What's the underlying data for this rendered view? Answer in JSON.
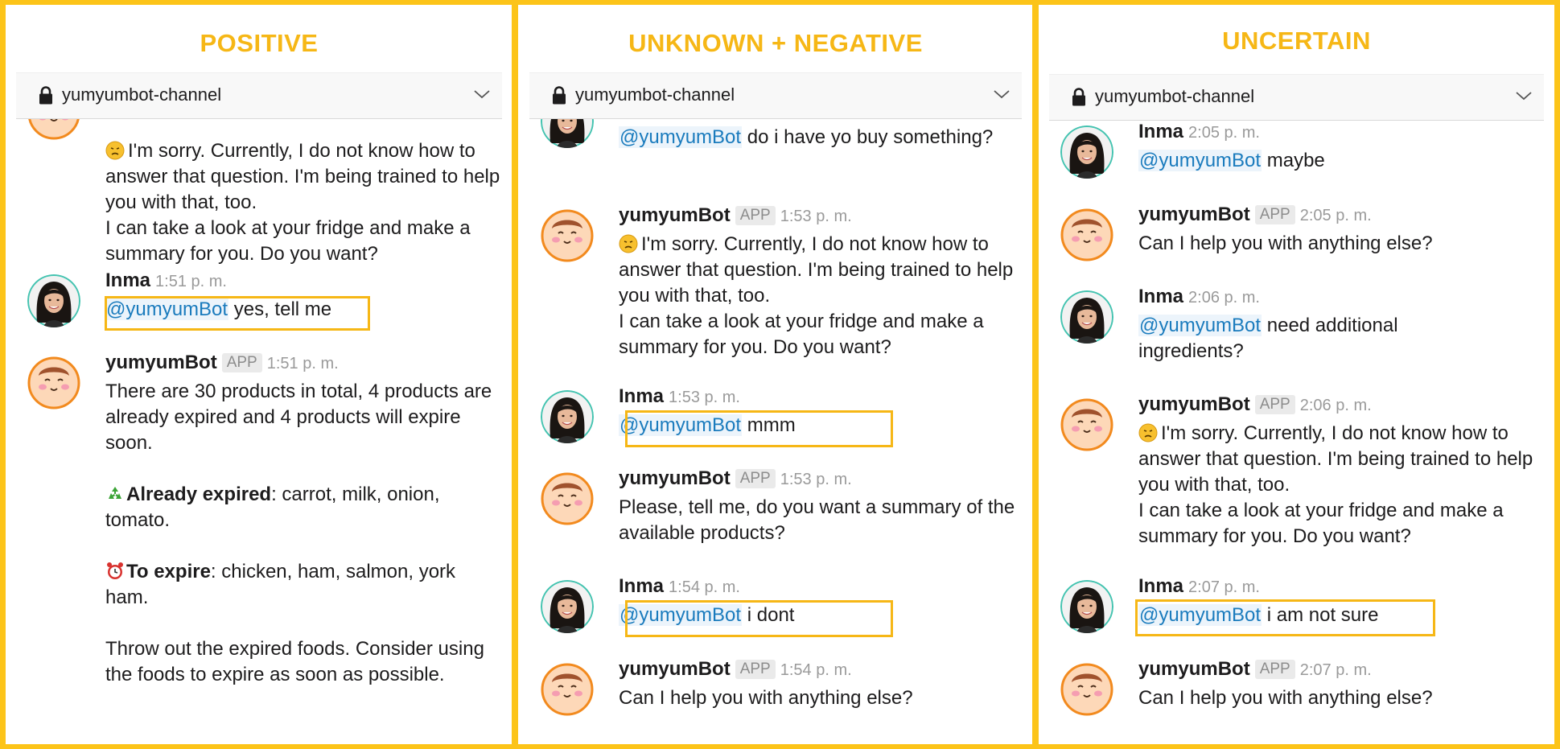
{
  "panels": [
    {
      "title": "POSITIVE",
      "channel": "yumyumbot-channel",
      "messages": [
        {
          "kind": "bot",
          "partial": true,
          "lines": [
            "I'm sorry. Currently, I do not know how to answer that question. I'm being trained to help you with that, too.",
            "I can take a look at your fridge and make a summary for you. Do you want?"
          ]
        },
        {
          "kind": "user",
          "author": "Inma",
          "time": "1:51 p. m.",
          "mention": "@yumyumBot",
          "text": " yes, tell me"
        },
        {
          "kind": "bot",
          "author": "yumyumBot",
          "badge": "APP",
          "time": "1:51 p. m.",
          "summary": "There are 30 products in total, 4 products are already expired and 4 products will expire soon.",
          "expired_label": "Already expired",
          "expired_items": ": carrot, milk, onion, tomato.",
          "expire_label": "To expire",
          "expire_items": ": chicken, ham, salmon, york ham.",
          "advice": "Throw out the expired foods. Consider using the foods to expire as soon as possible."
        }
      ]
    },
    {
      "title": "UNKNOWN + NEGATIVE",
      "channel": "yumyumbot-channel",
      "messages": [
        {
          "kind": "user",
          "partial": true,
          "mention": "@yumyumBot",
          "text": " do i have yo buy something?"
        },
        {
          "kind": "bot",
          "author": "yumyumBot",
          "badge": "APP",
          "time": "1:53 p. m.",
          "lines": [
            "I'm sorry. Currently, I do not know how to answer that question. I'm being trained to help you with that, too.",
            "I can take a look at your fridge and make a summary for you. Do you want?"
          ]
        },
        {
          "kind": "user",
          "author": "Inma",
          "time": "1:53 p. m.",
          "mention": "@yumyumBot",
          "text": " mmm"
        },
        {
          "kind": "bot",
          "author": "yumyumBot",
          "badge": "APP",
          "time": "1:53 p. m.",
          "text": "Please, tell me, do you want a summary of the available products?"
        },
        {
          "kind": "user",
          "author": "Inma",
          "time": "1:54 p. m.",
          "mention": "@yumyumBot",
          "text": " i dont"
        },
        {
          "kind": "bot",
          "author": "yumyumBot",
          "badge": "APP",
          "time": "1:54 p. m.",
          "text": "Can I help you with anything else?"
        }
      ]
    },
    {
      "title": "UNCERTAIN",
      "channel": "yumyumbot-channel",
      "messages": [
        {
          "kind": "user",
          "author": "Inma",
          "time": "2:05 p. m.",
          "mention": "@yumyumBot",
          "text": " maybe"
        },
        {
          "kind": "bot",
          "author": "yumyumBot",
          "badge": "APP",
          "time": "2:05 p. m.",
          "text": "Can I help you with anything else?"
        },
        {
          "kind": "user",
          "author": "Inma",
          "time": "2:06 p. m.",
          "mention": "@yumyumBot",
          "text": " need additional ingredients?"
        },
        {
          "kind": "bot",
          "author": "yumyumBot",
          "badge": "APP",
          "time": "2:06 p. m.",
          "lines": [
            "I'm sorry. Currently, I do not know how to answer that question. I'm being trained to help you with that, too.",
            "I can take a look at your fridge and make a summary for you. Do you want?"
          ]
        },
        {
          "kind": "user",
          "author": "Inma",
          "time": "2:07 p. m.",
          "mention": "@yumyumBot",
          "text": " i am not sure"
        },
        {
          "kind": "bot",
          "author": "yumyumBot",
          "badge": "APP",
          "time": "2:07 p. m.",
          "text": "Can I help you with anything else?"
        }
      ]
    }
  ],
  "icons": {
    "lock": "lock-icon",
    "chevron": "chevron-down-icon",
    "user_avatar": "user-avatar-inma",
    "bot_avatar": "bot-avatar-yumyumbot",
    "sad": "disappointed-face-emoji",
    "recycle": "recycle-emoji",
    "alarm": "alarm-clock-emoji"
  },
  "colors": {
    "frame": "#fcc419",
    "title": "#f6b716",
    "mention": "#1a7bbd",
    "highlight": "#f6b716"
  }
}
